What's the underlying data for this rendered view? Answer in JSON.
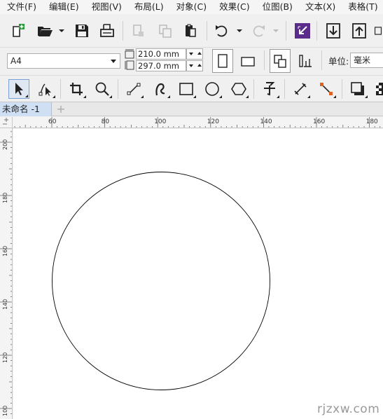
{
  "menu": [
    "文件(F)",
    "编辑(E)",
    "视图(V)",
    "布局(L)",
    "对象(C)",
    "效果(C)",
    "位图(B)",
    "文本(X)",
    "表格(T)"
  ],
  "property_bar": {
    "page_size": "A4",
    "width": "210.0 mm",
    "height": "297.0 mm",
    "unit_label": "单位:",
    "unit_value": "毫米"
  },
  "document_tab": {
    "label": "未命名 -1",
    "add_symbol": "+"
  },
  "rulers": {
    "horizontal_labels": [
      "60",
      "80",
      "100",
      "120",
      "140",
      "160",
      "180"
    ],
    "vertical_labels": [
      "200",
      "180",
      "160",
      "140",
      "120",
      "100"
    ]
  },
  "canvas": {
    "shape": "circle",
    "stroke_color": "#000000",
    "fill_color": "none"
  },
  "watermark": "rjzxw.com",
  "colors": {
    "accent_purple": "#5a2d8c",
    "node_orange": "#e06020",
    "ui_background": "#f0f0f0",
    "active_tab": "#cfe0f5"
  }
}
